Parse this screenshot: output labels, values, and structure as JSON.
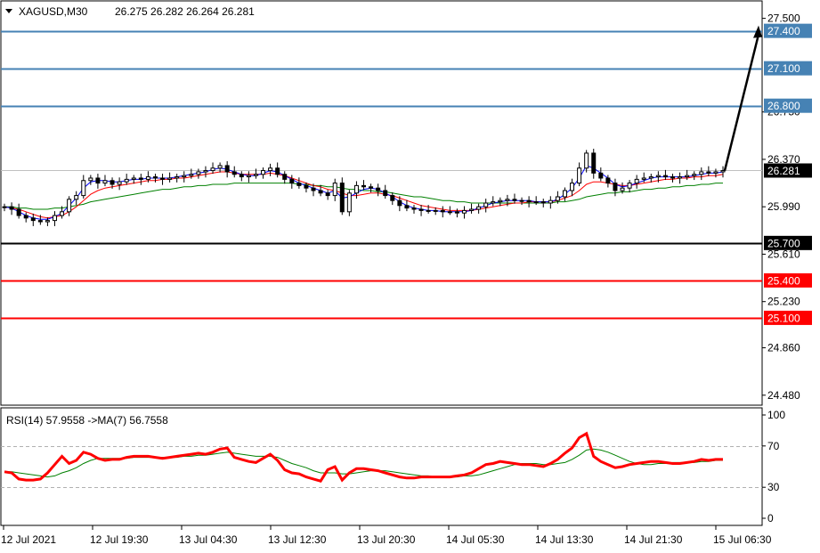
{
  "chart_data": [
    {
      "type": "candlestick",
      "header": {
        "symbol": "XAGUSD,M30",
        "ohlc": "26.275 26.282 26.264 26.281"
      },
      "ylim": [
        24.4,
        27.64
      ],
      "y_ticks": [
        "27.500",
        "26.750",
        "26.370",
        "25.990",
        "25.610",
        "25.230",
        "24.860",
        "24.480"
      ],
      "y_tick_values": [
        27.5,
        26.75,
        26.37,
        25.99,
        25.61,
        25.23,
        24.86,
        24.48
      ],
      "x_ticks": [
        "12 Jul 2021",
        "12 Jul 19:30",
        "13 Jul 04:30",
        "13 Jul 12:30",
        "13 Jul 20:30",
        "14 Jul 05:30",
        "14 Jul 13:30",
        "14 Jul 21:30",
        "15 Jul 06:30"
      ],
      "current_price": 26.281,
      "current_price_label": "26.281",
      "levels": [
        {
          "value": 27.4,
          "label": "27.400",
          "color": "#4682b4",
          "kind": "resistance"
        },
        {
          "value": 27.1,
          "label": "27.100",
          "color": "#4682b4",
          "kind": "resistance"
        },
        {
          "value": 26.8,
          "label": "26.800",
          "color": "#4682b4",
          "kind": "resistance"
        },
        {
          "value": 25.7,
          "label": "25.700",
          "color": "#000000",
          "kind": "pivot"
        },
        {
          "value": 25.4,
          "label": "25.400",
          "color": "#ff0000",
          "kind": "support"
        },
        {
          "value": 25.1,
          "label": "25.100",
          "color": "#ff0000",
          "kind": "support"
        }
      ],
      "close": [
        25.99,
        25.97,
        25.92,
        25.9,
        25.88,
        25.87,
        25.88,
        25.92,
        25.95,
        26.05,
        26.08,
        26.2,
        26.22,
        26.18,
        26.2,
        26.17,
        26.19,
        26.21,
        26.22,
        26.21,
        26.23,
        26.22,
        26.21,
        26.22,
        26.23,
        26.24,
        26.25,
        26.27,
        26.28,
        26.3,
        26.32,
        26.27,
        26.25,
        26.23,
        26.24,
        26.25,
        26.28,
        26.3,
        26.25,
        26.21,
        26.18,
        26.16,
        26.14,
        26.12,
        26.1,
        26.08,
        26.18,
        25.95,
        26.1,
        26.16,
        26.15,
        26.14,
        26.12,
        26.08,
        26.04,
        26.0,
        25.98,
        25.97,
        25.96,
        25.96,
        25.96,
        25.95,
        25.95,
        25.94,
        25.96,
        25.97,
        25.99,
        26.02,
        26.03,
        26.04,
        26.05,
        26.04,
        26.04,
        26.03,
        26.03,
        26.02,
        26.04,
        26.07,
        26.12,
        26.18,
        26.3,
        26.42,
        26.26,
        26.22,
        26.18,
        26.12,
        26.14,
        26.18,
        26.21,
        26.22,
        26.23,
        26.24,
        26.23,
        26.22,
        26.23,
        26.24,
        26.25,
        26.27,
        26.26,
        26.27,
        26.28
      ],
      "ma_fast": [
        25.99,
        25.98,
        25.95,
        25.92,
        25.9,
        25.89,
        25.89,
        25.91,
        25.94,
        26.0,
        26.06,
        26.14,
        26.19,
        26.2,
        26.2,
        26.19,
        26.19,
        26.2,
        26.21,
        26.21,
        26.22,
        26.22,
        26.22,
        26.22,
        26.23,
        26.24,
        26.25,
        26.26,
        26.27,
        26.29,
        26.3,
        26.29,
        26.27,
        26.25,
        26.24,
        26.24,
        26.26,
        26.28,
        26.27,
        26.24,
        26.21,
        26.18,
        26.16,
        26.14,
        26.12,
        26.1,
        26.12,
        26.06,
        26.07,
        26.1,
        26.13,
        26.14,
        26.13,
        26.1,
        26.07,
        26.03,
        26.0,
        25.98,
        25.97,
        25.96,
        25.96,
        25.95,
        25.95,
        25.95,
        25.95,
        25.96,
        25.98,
        26.0,
        26.02,
        26.03,
        26.04,
        26.04,
        26.04,
        26.04,
        26.03,
        26.03,
        26.03,
        26.05,
        26.09,
        26.14,
        26.22,
        26.32,
        26.3,
        26.26,
        26.22,
        26.17,
        26.15,
        26.16,
        26.18,
        26.2,
        26.22,
        26.23,
        26.23,
        26.23,
        26.23,
        26.23,
        26.24,
        26.25,
        26.26,
        26.26,
        26.27
      ],
      "ma_mid": [
        25.99,
        25.98,
        25.97,
        25.95,
        25.93,
        25.91,
        25.9,
        25.91,
        25.92,
        25.95,
        25.99,
        26.04,
        26.09,
        26.12,
        26.14,
        26.15,
        26.16,
        26.17,
        26.18,
        26.19,
        26.2,
        26.2,
        26.21,
        26.21,
        26.22,
        26.22,
        26.23,
        26.24,
        26.25,
        26.26,
        26.27,
        26.27,
        26.26,
        26.25,
        26.25,
        26.25,
        26.25,
        26.26,
        26.25,
        26.24,
        26.22,
        26.2,
        26.18,
        26.16,
        26.15,
        26.13,
        26.12,
        26.1,
        26.08,
        26.08,
        26.09,
        26.1,
        26.1,
        26.09,
        26.08,
        26.06,
        26.04,
        26.02,
        26.0,
        25.99,
        25.98,
        25.97,
        25.96,
        25.96,
        25.96,
        25.96,
        25.97,
        25.98,
        25.99,
        26.0,
        26.01,
        26.02,
        26.02,
        26.03,
        26.03,
        26.03,
        26.03,
        26.04,
        26.06,
        26.08,
        26.12,
        26.17,
        26.19,
        26.19,
        26.18,
        26.17,
        26.16,
        26.16,
        26.17,
        26.18,
        26.19,
        26.2,
        26.21,
        26.21,
        26.22,
        26.22,
        26.23,
        26.23,
        26.24,
        26.24,
        26.25
      ],
      "ma_slow": [
        25.99,
        25.99,
        25.98,
        25.98,
        25.97,
        25.97,
        25.97,
        25.98,
        25.98,
        25.99,
        26.0,
        26.01,
        26.03,
        26.04,
        26.05,
        26.06,
        26.07,
        26.08,
        26.09,
        26.1,
        26.11,
        26.12,
        26.13,
        26.13,
        26.14,
        26.15,
        26.15,
        26.16,
        26.16,
        26.17,
        26.17,
        26.17,
        26.18,
        26.18,
        26.18,
        26.18,
        26.18,
        26.18,
        26.18,
        26.18,
        26.18,
        26.17,
        26.17,
        26.16,
        26.16,
        26.15,
        26.15,
        26.14,
        26.13,
        26.13,
        26.12,
        26.12,
        26.11,
        26.11,
        26.1,
        26.09,
        26.08,
        26.07,
        26.07,
        26.06,
        26.05,
        26.04,
        26.04,
        26.03,
        26.03,
        26.02,
        26.02,
        26.02,
        26.02,
        26.02,
        26.02,
        26.02,
        26.02,
        26.02,
        26.02,
        26.02,
        26.02,
        26.03,
        26.03,
        26.04,
        26.05,
        26.07,
        26.08,
        26.09,
        26.1,
        26.1,
        26.11,
        26.11,
        26.12,
        26.13,
        26.13,
        26.14,
        26.14,
        26.15,
        26.15,
        26.16,
        26.16,
        26.17,
        26.17,
        26.18,
        26.18
      ],
      "projection": {
        "from": 26.28,
        "to": 27.4
      }
    },
    {
      "type": "line",
      "header": "RSI(14) 57.9558  ->MA(7) 56.7558",
      "ylim": [
        0,
        100
      ],
      "y_ticks": [
        "100",
        "70",
        "30",
        "0"
      ],
      "y_tick_values": [
        100,
        70,
        30,
        0
      ],
      "levels": [
        70,
        30
      ],
      "series": [
        {
          "name": "RSI(14)",
          "color": "#ff0000",
          "values": [
            45,
            44,
            38,
            37,
            37,
            38,
            44,
            52,
            60,
            53,
            56,
            64,
            62,
            58,
            56,
            57,
            57,
            59,
            60,
            60,
            60,
            59,
            58,
            59,
            60,
            61,
            62,
            63,
            62,
            64,
            67,
            68,
            59,
            57,
            55,
            54,
            58,
            62,
            56,
            47,
            44,
            43,
            40,
            38,
            36,
            47,
            50,
            37,
            44,
            48,
            48,
            47,
            46,
            44,
            42,
            40,
            39,
            39,
            40,
            40,
            40,
            40,
            40,
            41,
            42,
            44,
            48,
            52,
            53,
            55,
            54,
            53,
            52,
            52,
            51,
            50,
            53,
            57,
            63,
            68,
            78,
            82,
            60,
            55,
            52,
            49,
            50,
            52,
            53,
            54,
            55,
            55,
            54,
            53,
            53,
            54,
            55,
            57,
            56,
            57,
            57
          ]
        },
        {
          "name": "MA(7)",
          "color": "#008000",
          "values": [
            45,
            45,
            44,
            43,
            42,
            41,
            40,
            41,
            44,
            46,
            49,
            53,
            56,
            58,
            58,
            58,
            58,
            58,
            59,
            59,
            59,
            59,
            59,
            59,
            59,
            60,
            60,
            61,
            61,
            62,
            63,
            64,
            63,
            62,
            61,
            60,
            60,
            60,
            59,
            56,
            53,
            51,
            49,
            46,
            44,
            44,
            44,
            43,
            43,
            44,
            45,
            46,
            46,
            46,
            45,
            44,
            43,
            42,
            41,
            41,
            40,
            40,
            40,
            40,
            41,
            41,
            42,
            44,
            46,
            48,
            50,
            52,
            53,
            53,
            53,
            52,
            52,
            53,
            54,
            57,
            61,
            66,
            67,
            66,
            64,
            61,
            58,
            55,
            53,
            52,
            52,
            53,
            53,
            54,
            54,
            54,
            54,
            55,
            55,
            56,
            56
          ]
        }
      ]
    }
  ],
  "price_axis": {
    "last_label": "26.281"
  }
}
